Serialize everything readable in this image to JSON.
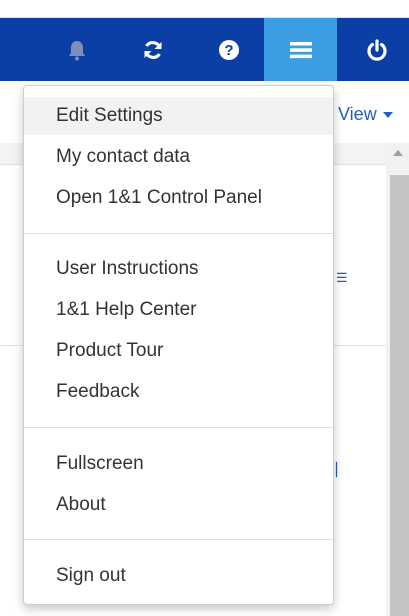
{
  "toolbar": {
    "buttons": [
      {
        "icon": "bell-icon",
        "label": ""
      },
      {
        "icon": "refresh-icon",
        "label": ""
      },
      {
        "icon": "help-icon",
        "label": "?"
      },
      {
        "icon": "menu-icon",
        "label": ""
      },
      {
        "icon": "power-icon",
        "label": ""
      }
    ],
    "active": "menu-icon"
  },
  "subheader": {
    "view_label": "View"
  },
  "menu": {
    "groups": [
      [
        "Edit Settings",
        "My contact data",
        "Open 1&1 Control Panel"
      ],
      [
        "User Instructions",
        "1&1 Help Center",
        "Product Tour",
        "Feedback"
      ],
      [
        "Fullscreen",
        "About"
      ],
      [
        "Sign out"
      ]
    ],
    "hovered_item": "Edit Settings"
  },
  "colors": {
    "toolbar_bg": "#0b3fa6",
    "toolbar_active": "#3b9ee1",
    "menu_text": "#333333",
    "link": "#1f5fbf"
  }
}
